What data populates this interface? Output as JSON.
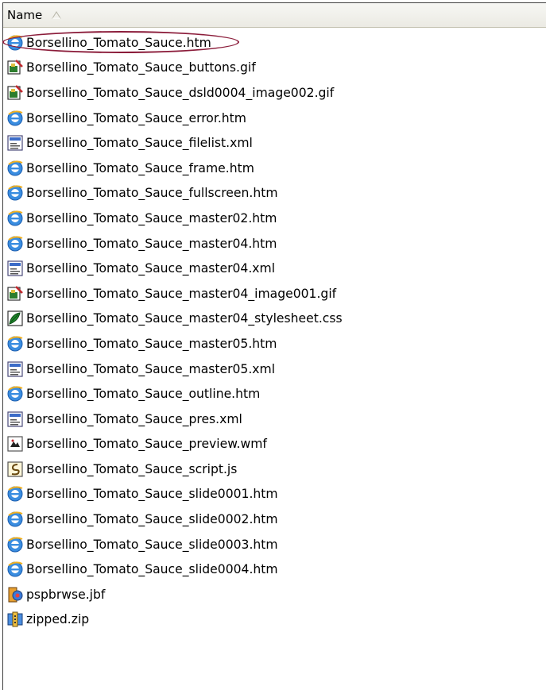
{
  "header": {
    "name_label": "Name"
  },
  "files": [
    {
      "name": "Borsellino_Tomato_Sauce.htm",
      "icon": "ie-icon"
    },
    {
      "name": "Borsellino_Tomato_Sauce_buttons.gif",
      "icon": "gif-image-icon"
    },
    {
      "name": "Borsellino_Tomato_Sauce_dsld0004_image002.gif",
      "icon": "gif-image-icon"
    },
    {
      "name": "Borsellino_Tomato_Sauce_error.htm",
      "icon": "ie-icon"
    },
    {
      "name": "Borsellino_Tomato_Sauce_filelist.xml",
      "icon": "xml-icon"
    },
    {
      "name": "Borsellino_Tomato_Sauce_frame.htm",
      "icon": "ie-icon"
    },
    {
      "name": "Borsellino_Tomato_Sauce_fullscreen.htm",
      "icon": "ie-icon"
    },
    {
      "name": "Borsellino_Tomato_Sauce_master02.htm",
      "icon": "ie-icon"
    },
    {
      "name": "Borsellino_Tomato_Sauce_master04.htm",
      "icon": "ie-icon"
    },
    {
      "name": "Borsellino_Tomato_Sauce_master04.xml",
      "icon": "xml-icon"
    },
    {
      "name": "Borsellino_Tomato_Sauce_master04_image001.gif",
      "icon": "gif-image-icon"
    },
    {
      "name": "Borsellino_Tomato_Sauce_master04_stylesheet.css",
      "icon": "css-icon"
    },
    {
      "name": "Borsellino_Tomato_Sauce_master05.htm",
      "icon": "ie-icon"
    },
    {
      "name": "Borsellino_Tomato_Sauce_master05.xml",
      "icon": "xml-icon"
    },
    {
      "name": "Borsellino_Tomato_Sauce_outline.htm",
      "icon": "ie-icon"
    },
    {
      "name": "Borsellino_Tomato_Sauce_pres.xml",
      "icon": "xml-icon"
    },
    {
      "name": "Borsellino_Tomato_Sauce_preview.wmf",
      "icon": "wmf-icon"
    },
    {
      "name": "Borsellino_Tomato_Sauce_script.js",
      "icon": "script-icon"
    },
    {
      "name": "Borsellino_Tomato_Sauce_slide0001.htm",
      "icon": "ie-icon"
    },
    {
      "name": "Borsellino_Tomato_Sauce_slide0002.htm",
      "icon": "ie-icon"
    },
    {
      "name": "Borsellino_Tomato_Sauce_slide0003.htm",
      "icon": "ie-icon"
    },
    {
      "name": "Borsellino_Tomato_Sauce_slide0004.htm",
      "icon": "ie-icon"
    },
    {
      "name": "pspbrwse.jbf",
      "icon": "jbf-icon"
    },
    {
      "name": "zipped.zip",
      "icon": "zip-icon"
    }
  ],
  "highlighted_file_index": 0,
  "highlight_color": "#8b1c3a"
}
